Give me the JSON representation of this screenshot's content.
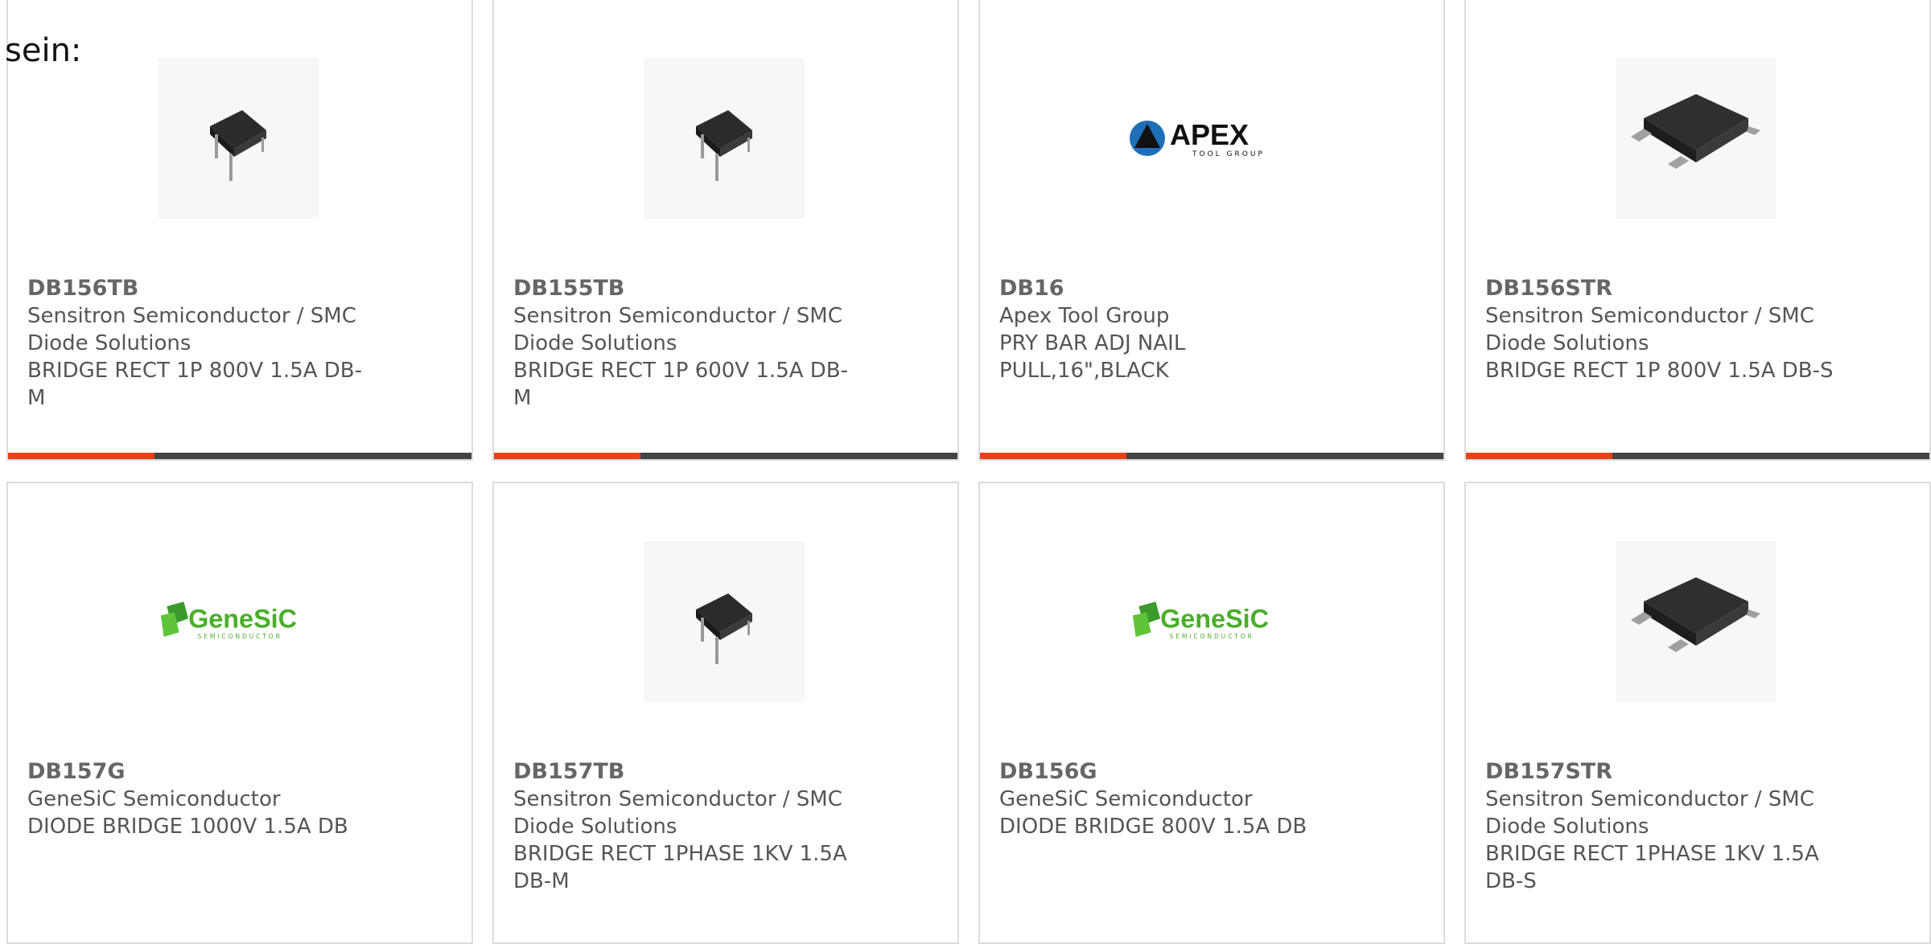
{
  "label": "sein:",
  "accent_color": "#e8421a",
  "cards": [
    {
      "part": "DB156TB",
      "manufacturer": "Sensitron Semiconductor / SMC Diode Solutions",
      "description": "BRIDGE RECT 1P 800V 1.5A DB-M",
      "image": "dip-bridge-icon"
    },
    {
      "part": "DB155TB",
      "manufacturer": "Sensitron Semiconductor / SMC Diode Solutions",
      "description": "BRIDGE RECT 1P 600V 1.5A DB-M",
      "image": "dip-bridge-icon"
    },
    {
      "part": "DB16",
      "manufacturer": "Apex Tool Group",
      "description": "PRY BAR ADJ NAIL PULL,16\",BLACK",
      "image": "apex-logo",
      "logo_text": "APEX",
      "logo_sub": "TOOL GROUP"
    },
    {
      "part": "DB156STR",
      "manufacturer": "Sensitron Semiconductor / SMC Diode Solutions",
      "description": "BRIDGE RECT 1P 800V 1.5A DB-S",
      "image": "smd-bridge-icon"
    },
    {
      "part": "DB157G",
      "manufacturer": "GeneSiC Semiconductor",
      "description": "DIODE BRIDGE 1000V 1.5A DB",
      "image": "genesic-logo",
      "logo_text": "GeneSiC",
      "logo_sub": "SEMICONDUCTOR"
    },
    {
      "part": "DB157TB",
      "manufacturer": "Sensitron Semiconductor / SMC Diode Solutions",
      "description": "BRIDGE RECT 1PHASE 1KV 1.5A DB-M",
      "image": "dip-bridge-icon"
    },
    {
      "part": "DB156G",
      "manufacturer": "GeneSiC Semiconductor",
      "description": "DIODE BRIDGE 800V 1.5A DB",
      "image": "genesic-logo",
      "logo_text": "GeneSiC",
      "logo_sub": "SEMICONDUCTOR"
    },
    {
      "part": "DB157STR",
      "manufacturer": "Sensitron Semiconductor / SMC Diode Solutions",
      "description": "BRIDGE RECT 1PHASE 1KV 1.5A DB-S",
      "image": "smd-bridge-icon"
    }
  ]
}
